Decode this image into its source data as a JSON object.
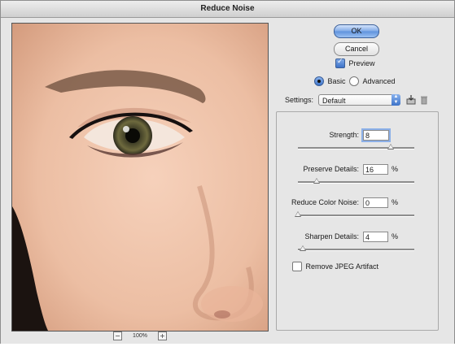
{
  "window": {
    "title": "Reduce Noise"
  },
  "buttons": {
    "ok": "OK",
    "cancel": "Cancel"
  },
  "preview": {
    "label": "Preview",
    "checked": true
  },
  "mode": {
    "basic": "Basic",
    "advanced": "Advanced",
    "selected": "basic"
  },
  "settings": {
    "label": "Settings:",
    "selected": "Default",
    "save_icon": "save-settings-icon",
    "delete_icon": "trash-icon"
  },
  "controls": [
    {
      "label": "Strength:",
      "value": "8",
      "unit": "",
      "slider_fraction": 0.8
    },
    {
      "label": "Preserve Details:",
      "value": "16",
      "unit": "%",
      "slider_fraction": 0.16
    },
    {
      "label": "Reduce Color Noise:",
      "value": "0",
      "unit": "%",
      "slider_fraction": 0.0
    },
    {
      "label": "Sharpen Details:",
      "value": "4",
      "unit": "%",
      "slider_fraction": 0.04
    }
  ],
  "jpeg": {
    "label": "Remove JPEG Artifact",
    "checked": false
  },
  "zoom": {
    "level": "100%",
    "minus": "−",
    "plus": "+"
  },
  "colors": {
    "accent": "#5e92dd",
    "window_bg": "#e6e6e6"
  }
}
